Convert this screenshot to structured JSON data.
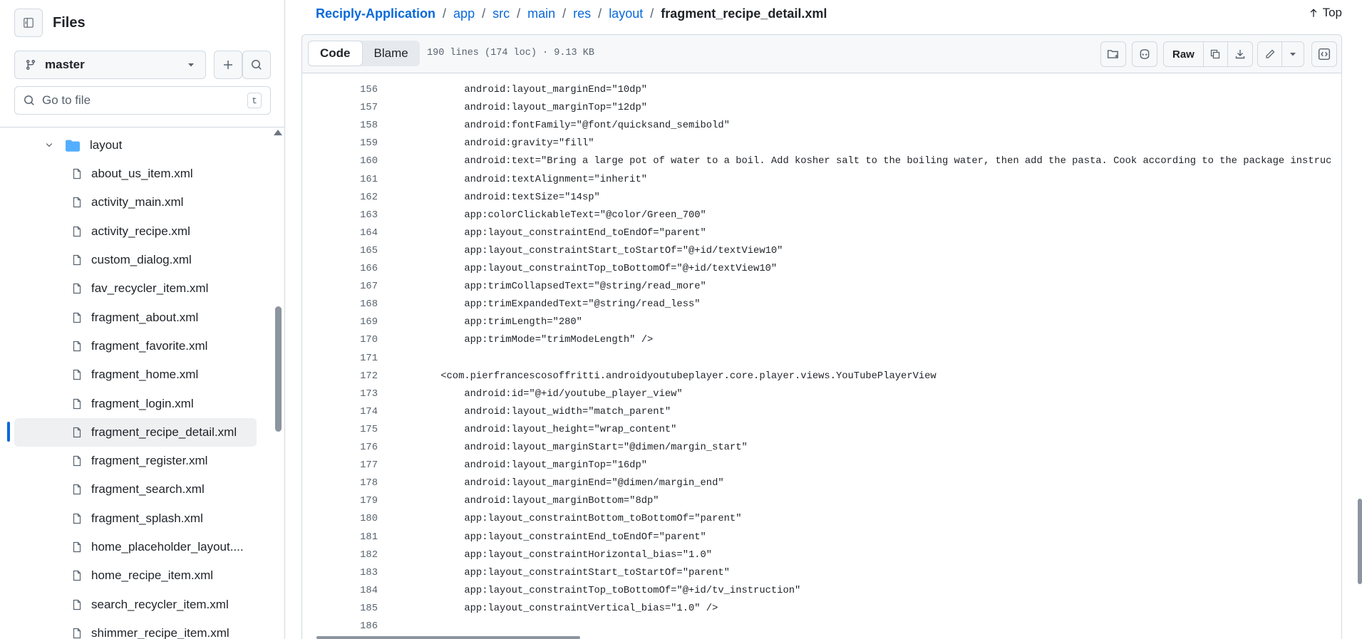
{
  "sidebar": {
    "title": "Files",
    "branch": "master",
    "goto_placeholder": "Go to file",
    "goto_shortcut": "t",
    "folder": "layout",
    "files": [
      "about_us_item.xml",
      "activity_main.xml",
      "activity_recipe.xml",
      "custom_dialog.xml",
      "fav_recycler_item.xml",
      "fragment_about.xml",
      "fragment_favorite.xml",
      "fragment_home.xml",
      "fragment_login.xml",
      "fragment_recipe_detail.xml",
      "fragment_register.xml",
      "fragment_search.xml",
      "fragment_splash.xml",
      "home_placeholder_layout....",
      "home_recipe_item.xml",
      "search_recycler_item.xml",
      "shimmer_recipe_item.xml"
    ],
    "active_index": 9
  },
  "breadcrumb": {
    "repo": "Reciply-Application",
    "parts": [
      "app",
      "src",
      "main",
      "res",
      "layout"
    ],
    "file": "fragment_recipe_detail.xml",
    "top_label": "Top"
  },
  "toolbar": {
    "tab_code": "Code",
    "tab_blame": "Blame",
    "meta": "190 lines (174 loc) · 9.13 KB",
    "raw_label": "Raw"
  },
  "code": {
    "lines": [
      {
        "n": "156",
        "text": "            android:layout_marginEnd=\"10dp\""
      },
      {
        "n": "157",
        "text": "            android:layout_marginTop=\"12dp\""
      },
      {
        "n": "158",
        "text": "            android:fontFamily=\"@font/quicksand_semibold\""
      },
      {
        "n": "159",
        "text": "            android:gravity=\"fill\""
      },
      {
        "n": "160",
        "text": "            android:text=\"Bring a large pot of water to a boil. Add kosher salt to the boiling water, then add the pasta. Cook according to the package instruc"
      },
      {
        "n": "161",
        "text": "            android:textAlignment=\"inherit\""
      },
      {
        "n": "162",
        "text": "            android:textSize=\"14sp\""
      },
      {
        "n": "163",
        "text": "            app:colorClickableText=\"@color/Green_700\""
      },
      {
        "n": "164",
        "text": "            app:layout_constraintEnd_toEndOf=\"parent\""
      },
      {
        "n": "165",
        "text": "            app:layout_constraintStart_toStartOf=\"@+id/textView10\""
      },
      {
        "n": "166",
        "text": "            app:layout_constraintTop_toBottomOf=\"@+id/textView10\""
      },
      {
        "n": "167",
        "text": "            app:trimCollapsedText=\"@string/read_more\""
      },
      {
        "n": "168",
        "text": "            app:trimExpandedText=\"@string/read_less\""
      },
      {
        "n": "169",
        "text": "            app:trimLength=\"280\""
      },
      {
        "n": "170",
        "text": "            app:trimMode=\"trimModeLength\" />"
      },
      {
        "n": "171",
        "text": ""
      },
      {
        "n": "172",
        "text": "        <com.pierfrancescosoffritti.androidyoutubeplayer.core.player.views.YouTubePlayerView"
      },
      {
        "n": "173",
        "text": "            android:id=\"@+id/youtube_player_view\""
      },
      {
        "n": "174",
        "text": "            android:layout_width=\"match_parent\""
      },
      {
        "n": "175",
        "text": "            android:layout_height=\"wrap_content\""
      },
      {
        "n": "176",
        "text": "            android:layout_marginStart=\"@dimen/margin_start\""
      },
      {
        "n": "177",
        "text": "            android:layout_marginTop=\"16dp\""
      },
      {
        "n": "178",
        "text": "            android:layout_marginEnd=\"@dimen/margin_end\""
      },
      {
        "n": "179",
        "text": "            android:layout_marginBottom=\"8dp\""
      },
      {
        "n": "180",
        "text": "            app:layout_constraintBottom_toBottomOf=\"parent\""
      },
      {
        "n": "181",
        "text": "            app:layout_constraintEnd_toEndOf=\"parent\""
      },
      {
        "n": "182",
        "text": "            app:layout_constraintHorizontal_bias=\"1.0\""
      },
      {
        "n": "183",
        "text": "            app:layout_constraintStart_toStartOf=\"parent\""
      },
      {
        "n": "184",
        "text": "            app:layout_constraintTop_toBottomOf=\"@+id/tv_instruction\""
      },
      {
        "n": "185",
        "text": "            app:layout_constraintVertical_bias=\"1.0\" />"
      },
      {
        "n": "186",
        "text": ""
      }
    ]
  },
  "colors": {
    "link": "#0969da",
    "text": "#1f2328",
    "muted": "#59636e",
    "border": "#d1d9e0",
    "toolbar_bg": "#f6f8fa",
    "active_item_bg": "#eef0f2",
    "folder_icon": "#54aeff"
  },
  "icons": {
    "sidebar_toggle": "sidebar-collapse-icon",
    "branch": "git-branch-icon",
    "add": "plus-icon",
    "search": "search-icon",
    "folder": "folder-icon",
    "file": "file-icon",
    "top": "arrow-up-icon"
  }
}
